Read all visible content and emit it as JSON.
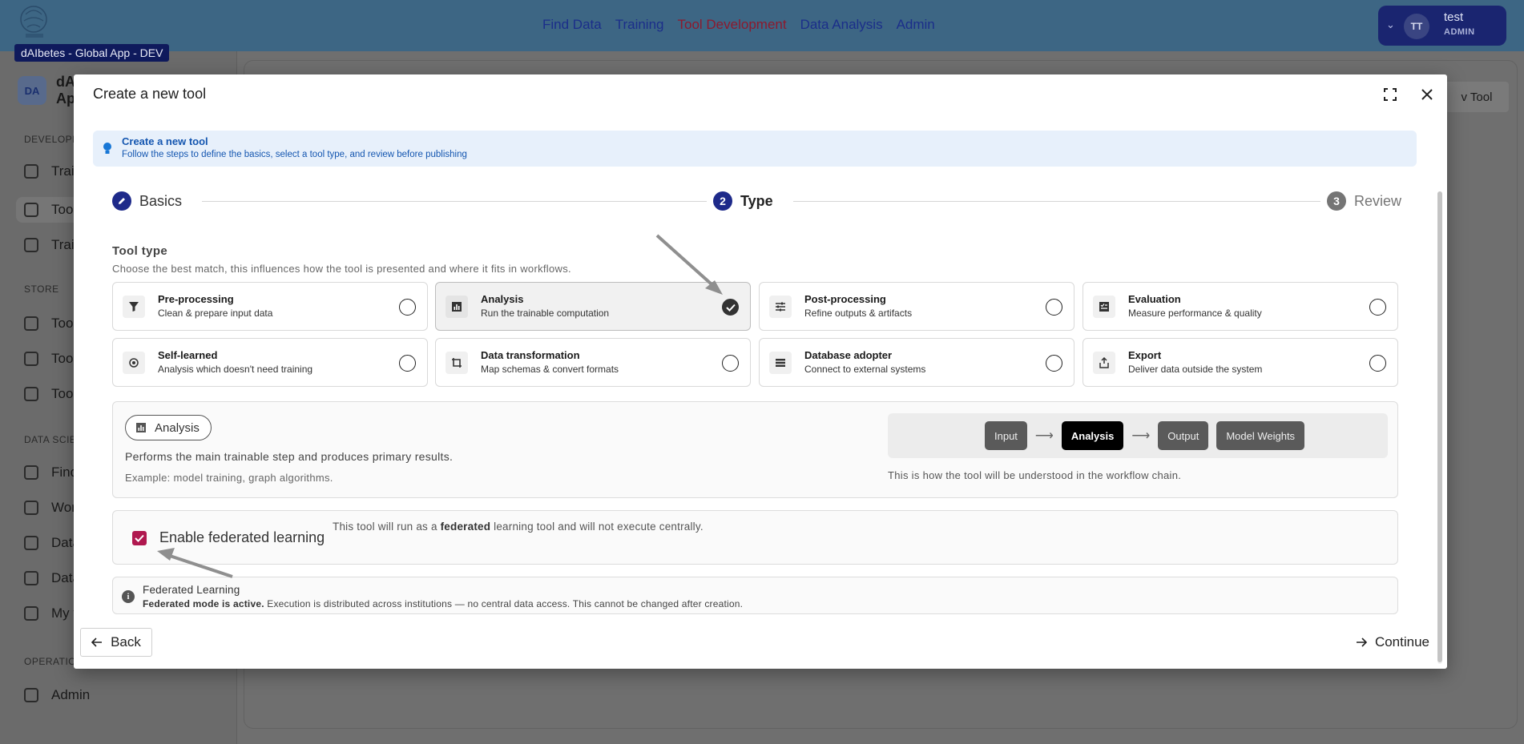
{
  "app": {
    "tooltip": "dAIbetes - Global App - DEV",
    "nav": [
      "Find Data",
      "Training",
      "Tool Development",
      "Data Analysis",
      "Admin"
    ],
    "nav_active": "Tool Development",
    "user": {
      "initials": "TT",
      "name": "test",
      "role": "ADMIN"
    },
    "workspace": {
      "initials": "DA",
      "name": "dAIbetes - Global App"
    },
    "sidebar": {
      "sections": [
        "DEVELOPM",
        "STORE",
        "DATA SCIEN",
        "OPERATIO"
      ],
      "items": [
        "Trai",
        "Tool",
        "Trai",
        "Tool",
        "Tool",
        "Tool",
        "Find",
        "Wor",
        "Data",
        "Data",
        "My f",
        "Admin"
      ]
    },
    "background_button": "v Tool"
  },
  "modal": {
    "title": "Create a new tool",
    "banner": {
      "title": "Create a new tool",
      "subtitle": "Follow the steps to define the basics, select a tool type, and review before publishing"
    },
    "steps": [
      {
        "num": "",
        "label": "Basics",
        "state": "done"
      },
      {
        "num": "2",
        "label": "Type",
        "state": "active"
      },
      {
        "num": "3",
        "label": "Review",
        "state": "pending"
      }
    ],
    "section_title": "Tool type",
    "section_subtitle": "Choose the best match, this influences how the tool is presented and where it fits in workflows.",
    "tool_types": [
      {
        "title": "Pre-processing",
        "subtitle": "Clean & prepare input data",
        "icon": "filter-icon",
        "selected": false
      },
      {
        "title": "Analysis",
        "subtitle": "Run the trainable computation",
        "icon": "chart-icon",
        "selected": true
      },
      {
        "title": "Post-processing",
        "subtitle": "Refine outputs & artifacts",
        "icon": "sliders-icon",
        "selected": false
      },
      {
        "title": "Evaluation",
        "subtitle": "Measure performance & quality",
        "icon": "checklist-icon",
        "selected": false
      },
      {
        "title": "Self-learned",
        "subtitle": "Analysis which doesn't need training",
        "icon": "self-learn-icon",
        "selected": false
      },
      {
        "title": "Data transformation",
        "subtitle": "Map schemas & convert formats",
        "icon": "crop-icon",
        "selected": false
      },
      {
        "title": "Database adopter",
        "subtitle": "Connect to external systems",
        "icon": "database-list-icon",
        "selected": false
      },
      {
        "title": "Export",
        "subtitle": "Deliver data outside the system",
        "icon": "share-icon",
        "selected": false
      }
    ],
    "preview": {
      "chip": "Analysis",
      "description": "Performs the main trainable step and produces primary results.",
      "example": "Example: model training, graph algorithms.",
      "flow": [
        "Input",
        "Analysis",
        "Output",
        "Model Weights"
      ],
      "flow_current": "Analysis",
      "flow_caption": "This is how the tool will be understood in the workflow chain."
    },
    "federated": {
      "checkbox_label": "Enable federated learning",
      "checked": true,
      "note_before": "This tool will run as a ",
      "note_bold": "federated",
      "note_after": " learning tool and will not execute centrally."
    },
    "fl_info": {
      "title": "Federated Learning",
      "bold": "Federated mode is active.",
      "text": " Execution is distributed across institutions — no central data access. This cannot be changed after creation."
    },
    "back_label": "Back",
    "continue_label": "Continue"
  },
  "colors": {
    "topbar": "#3d6684",
    "step_active": "#1e2a8a",
    "step_pending": "#757575",
    "checkbox": "#b0184f",
    "banner_bg": "#e7f0fb",
    "banner_text": "#1456b0"
  }
}
